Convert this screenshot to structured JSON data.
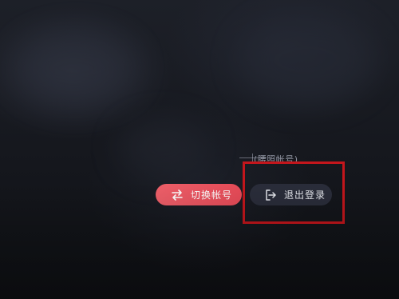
{
  "screen": {
    "caption_text": "(腰照帐号)"
  },
  "actions": {
    "switch_account": {
      "label": "切换帐号",
      "icon": "swap-arrows-icon"
    },
    "logout": {
      "label": "退出登录",
      "icon": "logout-icon"
    }
  },
  "annotation": {
    "highlight_color": "#c4161c"
  },
  "colors": {
    "switch_button": "#ee5a63",
    "logout_button": "#2a2d3a",
    "background": "#14161c"
  }
}
